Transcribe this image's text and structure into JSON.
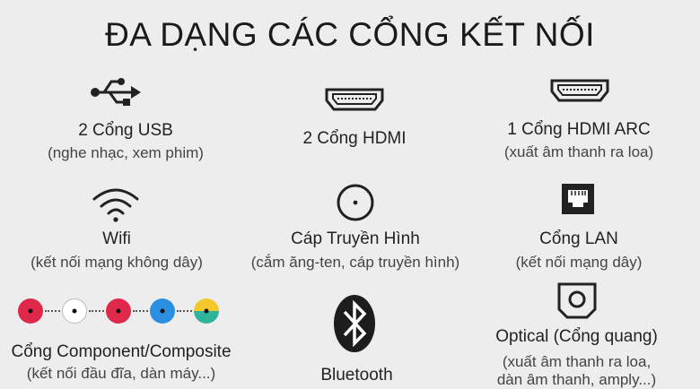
{
  "title": "ĐA DẠNG CÁC CỔNG KẾT NỐI",
  "ports": [
    {
      "name": "usb",
      "label": "2 Cổng USB",
      "sub": "(nghe nhạc, xem phim)",
      "icon": "usb-icon"
    },
    {
      "name": "hdmi",
      "label": "2 Cổng HDMI",
      "sub": "",
      "icon": "hdmi-icon"
    },
    {
      "name": "hdmi-arc",
      "label": "1 Cổng HDMI ARC",
      "sub": "(xuất âm thanh ra loa)",
      "icon": "hdmi-icon"
    },
    {
      "name": "wifi",
      "label": "Wifi",
      "sub": "(kết nối mạng không dây)",
      "icon": "wifi-icon"
    },
    {
      "name": "cable",
      "label": "Cáp Truyền Hình",
      "sub": "(cắm ăng-ten, cáp truyền hình)",
      "icon": "coax-icon"
    },
    {
      "name": "lan",
      "label": "Cổng LAN",
      "sub": "(kết nối mạng dây)",
      "icon": "ethernet-icon"
    },
    {
      "name": "component",
      "label": "Cổng Component/Composite",
      "sub": "(kết nối đầu đĩa, dàn máy...)",
      "icon": "rca-connectors-icon"
    },
    {
      "name": "bluetooth",
      "label": "Bluetooth",
      "sub": "",
      "icon": "bluetooth-icon"
    },
    {
      "name": "optical",
      "label": "Optical (Cổng quang)",
      "sub1": "(xuất âm thanh ra loa,",
      "sub2": "dàn âm thanh, amply...)",
      "icon": "optical-icon"
    }
  ],
  "colors": {
    "rca_red": "#e0284a",
    "rca_white": "#ffffff",
    "rca_blue": "#2a8fe0",
    "rca_yellow": "#f2c82a",
    "rca_green": "#2fb39a"
  }
}
